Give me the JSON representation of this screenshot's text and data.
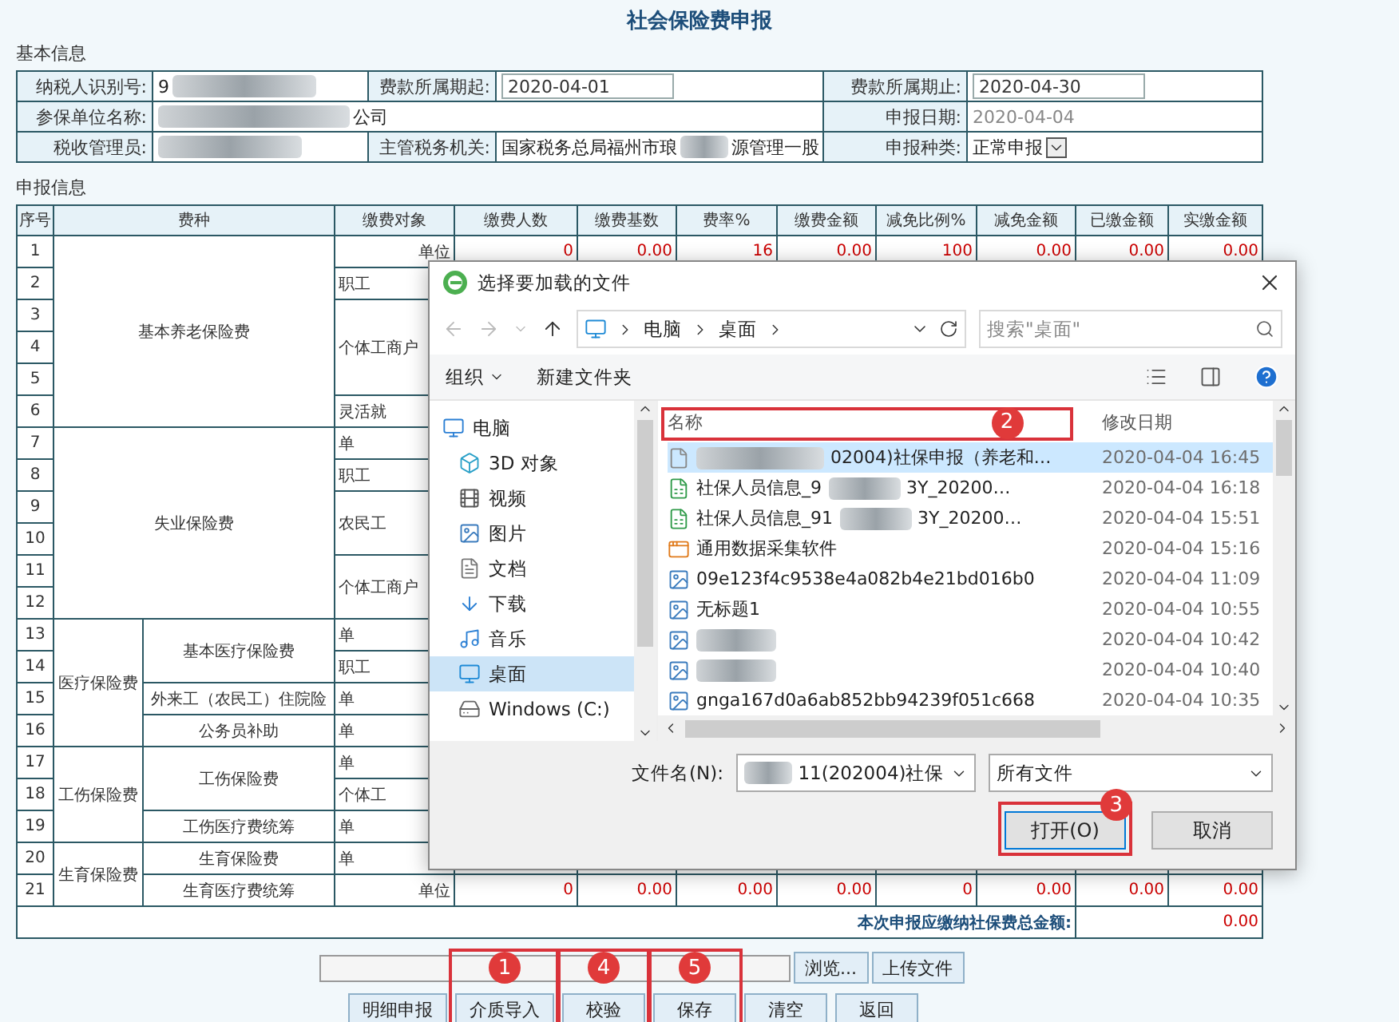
{
  "page_title": "社会保险费申报",
  "basic_info": {
    "heading": "基本信息",
    "rows": [
      [
        {
          "label": "纳税人识别号:",
          "value": "9",
          "kind": "text",
          "redacted": true
        },
        {
          "label": "费款所属期起:",
          "value": "2020-04-01",
          "kind": "input"
        },
        {
          "label": "费款所属期止:",
          "value": "2020-04-30",
          "kind": "input"
        }
      ],
      [
        {
          "label": "参保单位名称:",
          "value_after": "公司",
          "kind": "text",
          "redacted": true
        },
        "",
        {
          "label": "申报日期:",
          "value": "2020-04-04",
          "kind": "readonly"
        }
      ],
      [
        {
          "label": "税收管理员:",
          "kind": "text",
          "redacted": true
        },
        {
          "label": "主管税务机关:",
          "value": "国家税务总局福州市琅",
          "value_after": "源管理一股",
          "kind": "text",
          "redacted": true
        },
        {
          "label": "申报种类:",
          "value": "正常申报",
          "kind": "select"
        }
      ]
    ]
  },
  "declaration": {
    "heading": "申报信息",
    "columns": [
      "序号",
      "费种",
      "缴费对象",
      "缴费人数",
      "缴费基数",
      "费率%",
      "缴费金额",
      "减免比例%",
      "减免金额",
      "已缴金额",
      "实缴金额"
    ],
    "categories": [
      {
        "name": "基本养老保险费",
        "groups": [
          {
            "objects": [
              {
                "name": "单位",
                "rows": [
                  {
                    "seq": "1",
                    "values": [
                      "0",
                      "0.00",
                      "16",
                      "0.00",
                      "100",
                      "0.00",
                      "0.00",
                      "0.00"
                    ]
                  }
                ]
              },
              {
                "name": "职工",
                "rows": [
                  {
                    "seq": "2"
                  }
                ]
              },
              {
                "name": "个体工商户",
                "rows": [
                  {
                    "seq": "3"
                  },
                  {
                    "seq": "4"
                  },
                  {
                    "seq": "5"
                  }
                ]
              },
              {
                "name": "灵活就",
                "rows": [
                  {
                    "seq": "6"
                  }
                ]
              }
            ]
          }
        ]
      },
      {
        "name": "失业保险费",
        "groups": [
          {
            "objects": [
              {
                "name": "单",
                "rows": [
                  {
                    "seq": "7"
                  }
                ]
              },
              {
                "name": "职工",
                "rows": [
                  {
                    "seq": "8"
                  }
                ]
              },
              {
                "name": "农民工",
                "rows": [
                  {
                    "seq": "9"
                  },
                  {
                    "seq": "10"
                  }
                ]
              },
              {
                "name": "个体工商户",
                "rows": [
                  {
                    "seq": "11"
                  },
                  {
                    "seq": "12"
                  }
                ]
              }
            ]
          }
        ]
      },
      {
        "name": "医疗保险费",
        "groups": [
          {
            "name": "基本医疗保险费",
            "objects": [
              {
                "name": "单",
                "rows": [
                  {
                    "seq": "13"
                  }
                ]
              },
              {
                "name": "职工",
                "rows": [
                  {
                    "seq": "14"
                  }
                ]
              }
            ]
          },
          {
            "name": "外来工（农民工）住院险",
            "objects": [
              {
                "name": "单",
                "rows": [
                  {
                    "seq": "15"
                  }
                ]
              }
            ]
          },
          {
            "name": "公务员补助",
            "objects": [
              {
                "name": "单",
                "rows": [
                  {
                    "seq": "16"
                  }
                ]
              }
            ]
          }
        ]
      },
      {
        "name": "工伤保险费",
        "groups": [
          {
            "name": "工伤保险费",
            "objects": [
              {
                "name": "单",
                "rows": [
                  {
                    "seq": "17"
                  }
                ]
              },
              {
                "name": "个体工",
                "rows": [
                  {
                    "seq": "18"
                  }
                ]
              }
            ]
          },
          {
            "name": "工伤医疗费统筹",
            "objects": [
              {
                "name": "单",
                "rows": [
                  {
                    "seq": "19"
                  }
                ]
              }
            ]
          }
        ]
      },
      {
        "name": "生育保险费",
        "groups": [
          {
            "name": "生育保险费",
            "objects": [
              {
                "name": "单",
                "rows": [
                  {
                    "seq": "20"
                  }
                ]
              }
            ]
          },
          {
            "name": "生育医疗费统筹",
            "objects": [
              {
                "name": "单位",
                "rows": [
                  {
                    "seq": "21",
                    "values": [
                      "0",
                      "0.00",
                      "0.00",
                      "0.00",
                      "0",
                      "0.00",
                      "0.00",
                      "0.00"
                    ]
                  }
                ]
              }
            ]
          }
        ]
      }
    ],
    "total_label": "本次申报应缴纳社保费总金额:",
    "total_value": "0.00"
  },
  "upload": {
    "browse": "浏览...",
    "upload": "上传文件"
  },
  "actions": [
    {
      "label": "明细申报"
    },
    {
      "label": "介质导入",
      "marker": "1"
    },
    {
      "label": "校验",
      "marker": "4"
    },
    {
      "label": "保存",
      "marker": "5"
    },
    {
      "label": "清空"
    },
    {
      "label": "返回"
    }
  ],
  "file_dialog": {
    "title": "选择要加载的文件",
    "path": [
      "电脑",
      "桌面"
    ],
    "search_placeholder": "搜索\"桌面\"",
    "organize": "组织",
    "new_folder": "新建文件夹",
    "nav": [
      {
        "label": "电脑",
        "kind": "pc",
        "selected": false,
        "children": [
          {
            "label": "3D 对象",
            "kind": "cube",
            "selected": false
          },
          {
            "label": "视频",
            "kind": "video",
            "selected": false
          },
          {
            "label": "图片",
            "kind": "picture",
            "selected": false
          },
          {
            "label": "文档",
            "kind": "doc",
            "selected": false
          },
          {
            "label": "下载",
            "kind": "download",
            "selected": false
          },
          {
            "label": "音乐",
            "kind": "music",
            "selected": false
          },
          {
            "label": "桌面",
            "kind": "desktop",
            "selected": true
          },
          {
            "label": "Windows (C:)",
            "kind": "drive",
            "selected": false
          }
        ]
      }
    ],
    "columns": [
      "名称",
      "修改日期"
    ],
    "header_marker": "2",
    "files": [
      {
        "name_after": "02004)社保申报（养老和…",
        "modified": "2020-04-04 16:45",
        "kind": "blank",
        "selected": true,
        "redacted": true
      },
      {
        "name": "社保人员信息_9",
        "name_after": "3Y_20200…",
        "modified": "2020-04-04 16:18",
        "kind": "sheet",
        "selected": false,
        "redacted": true
      },
      {
        "name": "社保人员信息_91",
        "name_after": "3Y_20200…",
        "modified": "2020-04-04 15:51",
        "kind": "sheet",
        "selected": false,
        "redacted": true
      },
      {
        "name": "通用数据采集软件",
        "modified": "2020-04-04 15:16",
        "kind": "app",
        "selected": false,
        "redacted": false
      },
      {
        "name": "09e123f4c9538e4a082b4e21bd016b0",
        "modified": "2020-04-04 11:09",
        "kind": "image",
        "selected": false,
        "redacted": false
      },
      {
        "name": "无标题1",
        "modified": "2020-04-04 10:55",
        "kind": "image",
        "selected": false,
        "redacted": false
      },
      {
        "modified": "2020-04-04 10:42",
        "kind": "image",
        "selected": false,
        "redacted": true
      },
      {
        "modified": "2020-04-04 10:40",
        "kind": "image",
        "selected": false,
        "redacted": true
      },
      {
        "name": "gnga167d0a6ab852bb94239f051c668",
        "modified": "2020-04-04 10:35",
        "kind": "image",
        "selected": false,
        "redacted": false
      }
    ],
    "file_name_label": "文件名(N):",
    "file_name": "11(202004)社保",
    "file_name_redacted": true,
    "file_type": "所有文件",
    "open": "打开(O)",
    "open_marker": "3",
    "cancel": "取消"
  }
}
